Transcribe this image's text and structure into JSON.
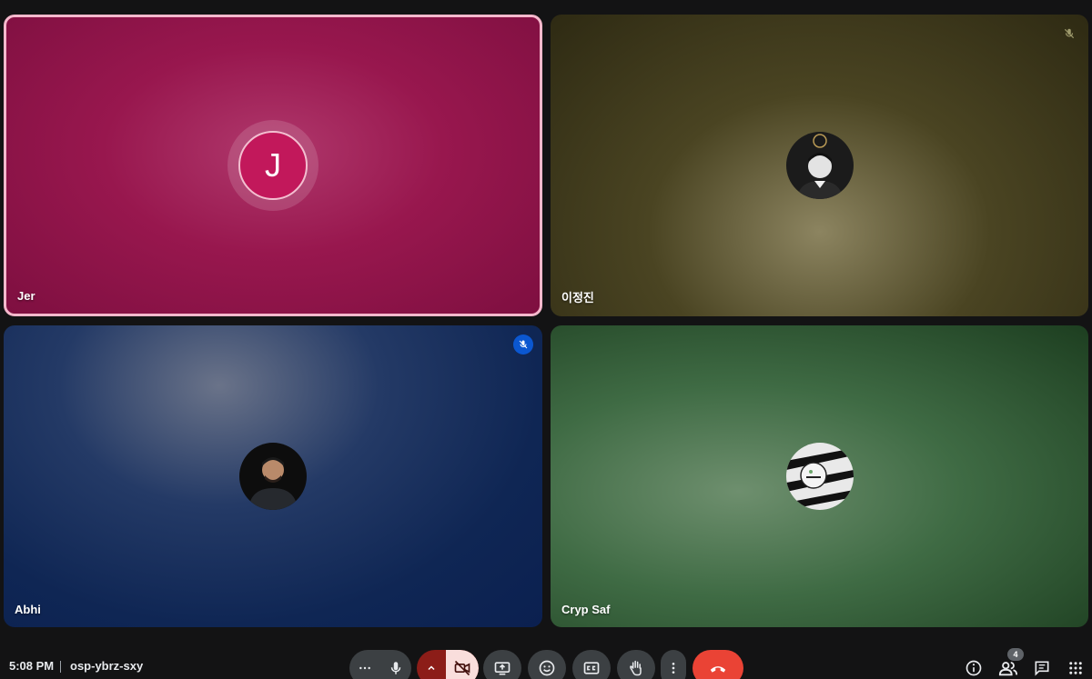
{
  "meeting": {
    "time": "5:08 PM",
    "code": "osp-ybrz-sxy"
  },
  "participants": [
    {
      "name": "Jer",
      "initial": "J"
    },
    {
      "name": "이정진"
    },
    {
      "name": "Abhi"
    },
    {
      "name": "Cryp Saf"
    }
  ],
  "toolbar": {
    "people_count": "4"
  },
  "icons": {
    "more-options": "more-horiz-icon",
    "mic": "mic-icon",
    "camera-off": "videocam-off-icon",
    "present": "present-screen-icon",
    "reactions": "emoji-icon",
    "captions": "captions-icon",
    "raise-hand": "hand-icon",
    "more-vert": "more-vert-icon",
    "leave": "call-end-icon",
    "info": "info-icon",
    "people": "people-icon",
    "chat": "chat-icon",
    "activities": "apps-grid-icon",
    "muted": "mic-off-icon"
  },
  "colors": {
    "background": "#131314",
    "control": "#3c4043",
    "leave_red": "#ea4335",
    "camera_off_bg": "#f9dedc",
    "camera_toggle_bg": "#8c1d18",
    "speaking_border": "#f5b8cc",
    "jer_avatar": "#c2185b",
    "muted_badge": "#0b57d0"
  }
}
